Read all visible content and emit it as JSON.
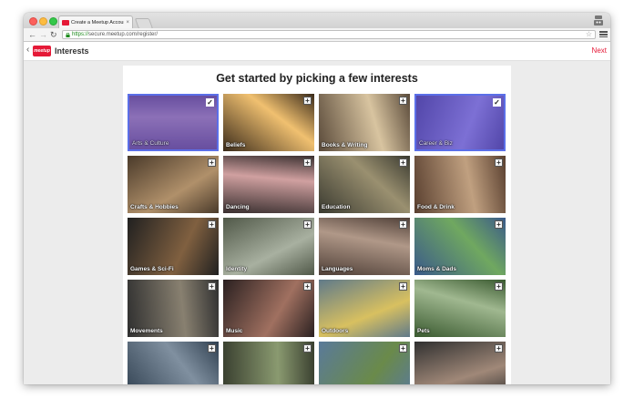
{
  "browser": {
    "tab_title": "Create a Meetup Account",
    "tab_close": "×",
    "url_https": "https://",
    "url_rest": "secure.meetup.com/register/"
  },
  "header": {
    "logo_text": "meetup",
    "title": "Interests",
    "next_label": "Next"
  },
  "main": {
    "heading": "Get started by picking a few interests"
  },
  "interests": [
    {
      "label": "Arts & Culture",
      "selected": true
    },
    {
      "label": "Beliefs",
      "selected": false
    },
    {
      "label": "Books & Writing",
      "selected": false
    },
    {
      "label": "Career & Biz",
      "selected": true
    },
    {
      "label": "Crafts & Hobbies",
      "selected": false
    },
    {
      "label": "Dancing",
      "selected": false
    },
    {
      "label": "Education",
      "selected": false
    },
    {
      "label": "Food & Drink",
      "selected": false
    },
    {
      "label": "Games & Sci-Fi",
      "selected": false
    },
    {
      "label": "Identity",
      "selected": false
    },
    {
      "label": "Languages",
      "selected": false
    },
    {
      "label": "Moms & Dads",
      "selected": false
    },
    {
      "label": "Movements",
      "selected": false
    },
    {
      "label": "Music",
      "selected": false
    },
    {
      "label": "Outdoors",
      "selected": false
    },
    {
      "label": "Pets",
      "selected": false
    },
    {
      "label": "",
      "selected": false
    },
    {
      "label": "",
      "selected": false
    },
    {
      "label": "",
      "selected": false
    },
    {
      "label": "",
      "selected": false
    }
  ],
  "icons": {
    "check": "✓",
    "plus": "+"
  },
  "colors": {
    "accent": "#e51937",
    "selected_border": "#5b6fe8"
  }
}
